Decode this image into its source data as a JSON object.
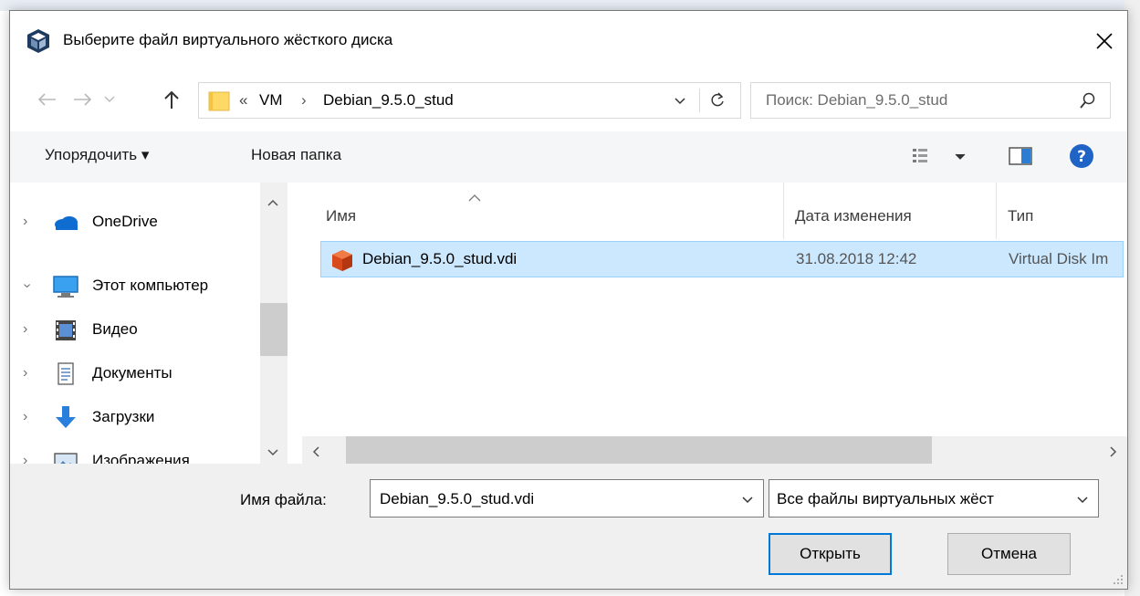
{
  "window": {
    "title": "Выберите файл виртуального жёсткого диска"
  },
  "address": {
    "overflow": "«",
    "crumbs": [
      "VM",
      "Debian_9.5.0_stud"
    ],
    "search_placeholder": "Поиск: Debian_9.5.0_stud"
  },
  "toolbar": {
    "organize_label": "Упорядочить ▾",
    "new_folder_label": "Новая папка"
  },
  "navpane": {
    "items": [
      {
        "label": "OneDrive",
        "icon": "onedrive-icon",
        "expanded": false
      },
      {
        "label": "Этот компьютер",
        "icon": "computer-icon",
        "expanded": true
      },
      {
        "label": "Видео",
        "icon": "video-icon",
        "expanded": false
      },
      {
        "label": "Документы",
        "icon": "documents-icon",
        "expanded": false
      },
      {
        "label": "Загрузки",
        "icon": "downloads-icon",
        "expanded": false
      },
      {
        "label": "Изображения",
        "icon": "pictures-icon",
        "expanded": false
      }
    ]
  },
  "list": {
    "columns": [
      "Имя",
      "Дата изменения",
      "Тип"
    ],
    "rows": [
      {
        "name": "Debian_9.5.0_stud.vdi",
        "date": "31.08.2018 12:42",
        "type": "Virtual Disk Im",
        "selected": true
      }
    ]
  },
  "footer": {
    "filename_label": "Имя файла:",
    "filename_value": "Debian_9.5.0_stud.vdi",
    "filter_value": "Все файлы виртуальных жёст",
    "open_label": "Открыть",
    "cancel_label": "Отмена"
  },
  "colors": {
    "selection": "#cce8ff",
    "selection_border": "#99d1ff",
    "accent": "#0078d7",
    "folder": "#ffd966"
  }
}
